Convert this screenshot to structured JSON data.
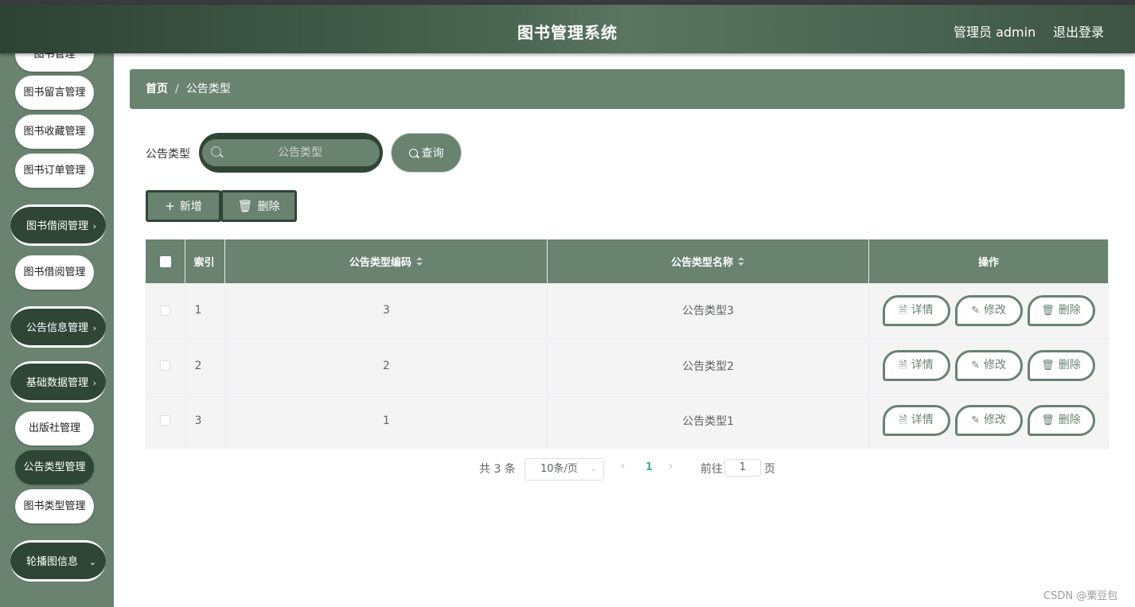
{
  "header": {
    "title": "图书管理系统",
    "user": "管理员 admin",
    "logout": "退出登录"
  },
  "sidebar": {
    "items": [
      {
        "label": "图书管理"
      },
      {
        "label": "图书留言管理"
      },
      {
        "label": "图书收藏管理"
      },
      {
        "label": "图书订单管理"
      },
      {
        "label": "图书借阅管理"
      },
      {
        "label": "图书借阅管理"
      },
      {
        "label": "公告信息管理"
      },
      {
        "label": "基础数据管理"
      },
      {
        "label": "出版社管理"
      },
      {
        "label": "公告类型管理"
      },
      {
        "label": "图书类型管理"
      },
      {
        "label": "轮播图信息"
      }
    ]
  },
  "breadcrumb": {
    "home": "首页",
    "separator": "/",
    "current": "公告类型"
  },
  "search": {
    "label": "公告类型",
    "placeholder": "公告类型",
    "button": "查询"
  },
  "toolbar": {
    "add": "新增",
    "delete": "删除"
  },
  "table": {
    "columns": [
      "索引",
      "公告类型编码",
      "公告类型名称",
      "操作"
    ],
    "rows": [
      {
        "index": "1",
        "code": "3",
        "name": "公告类型3"
      },
      {
        "index": "2",
        "code": "2",
        "name": "公告类型2"
      },
      {
        "index": "3",
        "code": "1",
        "name": "公告类型1"
      }
    ],
    "actions": {
      "detail": "详情",
      "edit": "修改",
      "delete": "删除"
    }
  },
  "pagination": {
    "total": "共 3 条",
    "page_size": "10条/页",
    "current_page": "1",
    "goto": "前往",
    "goto_value": "1",
    "page_unit": "页"
  },
  "watermark": "CSDN @栗豆包",
  "colors": {
    "header_dark": "#2d4233",
    "sidebar": "#6a8270",
    "accent_dark": "#2f4637",
    "page_active": "#3fae8f"
  }
}
